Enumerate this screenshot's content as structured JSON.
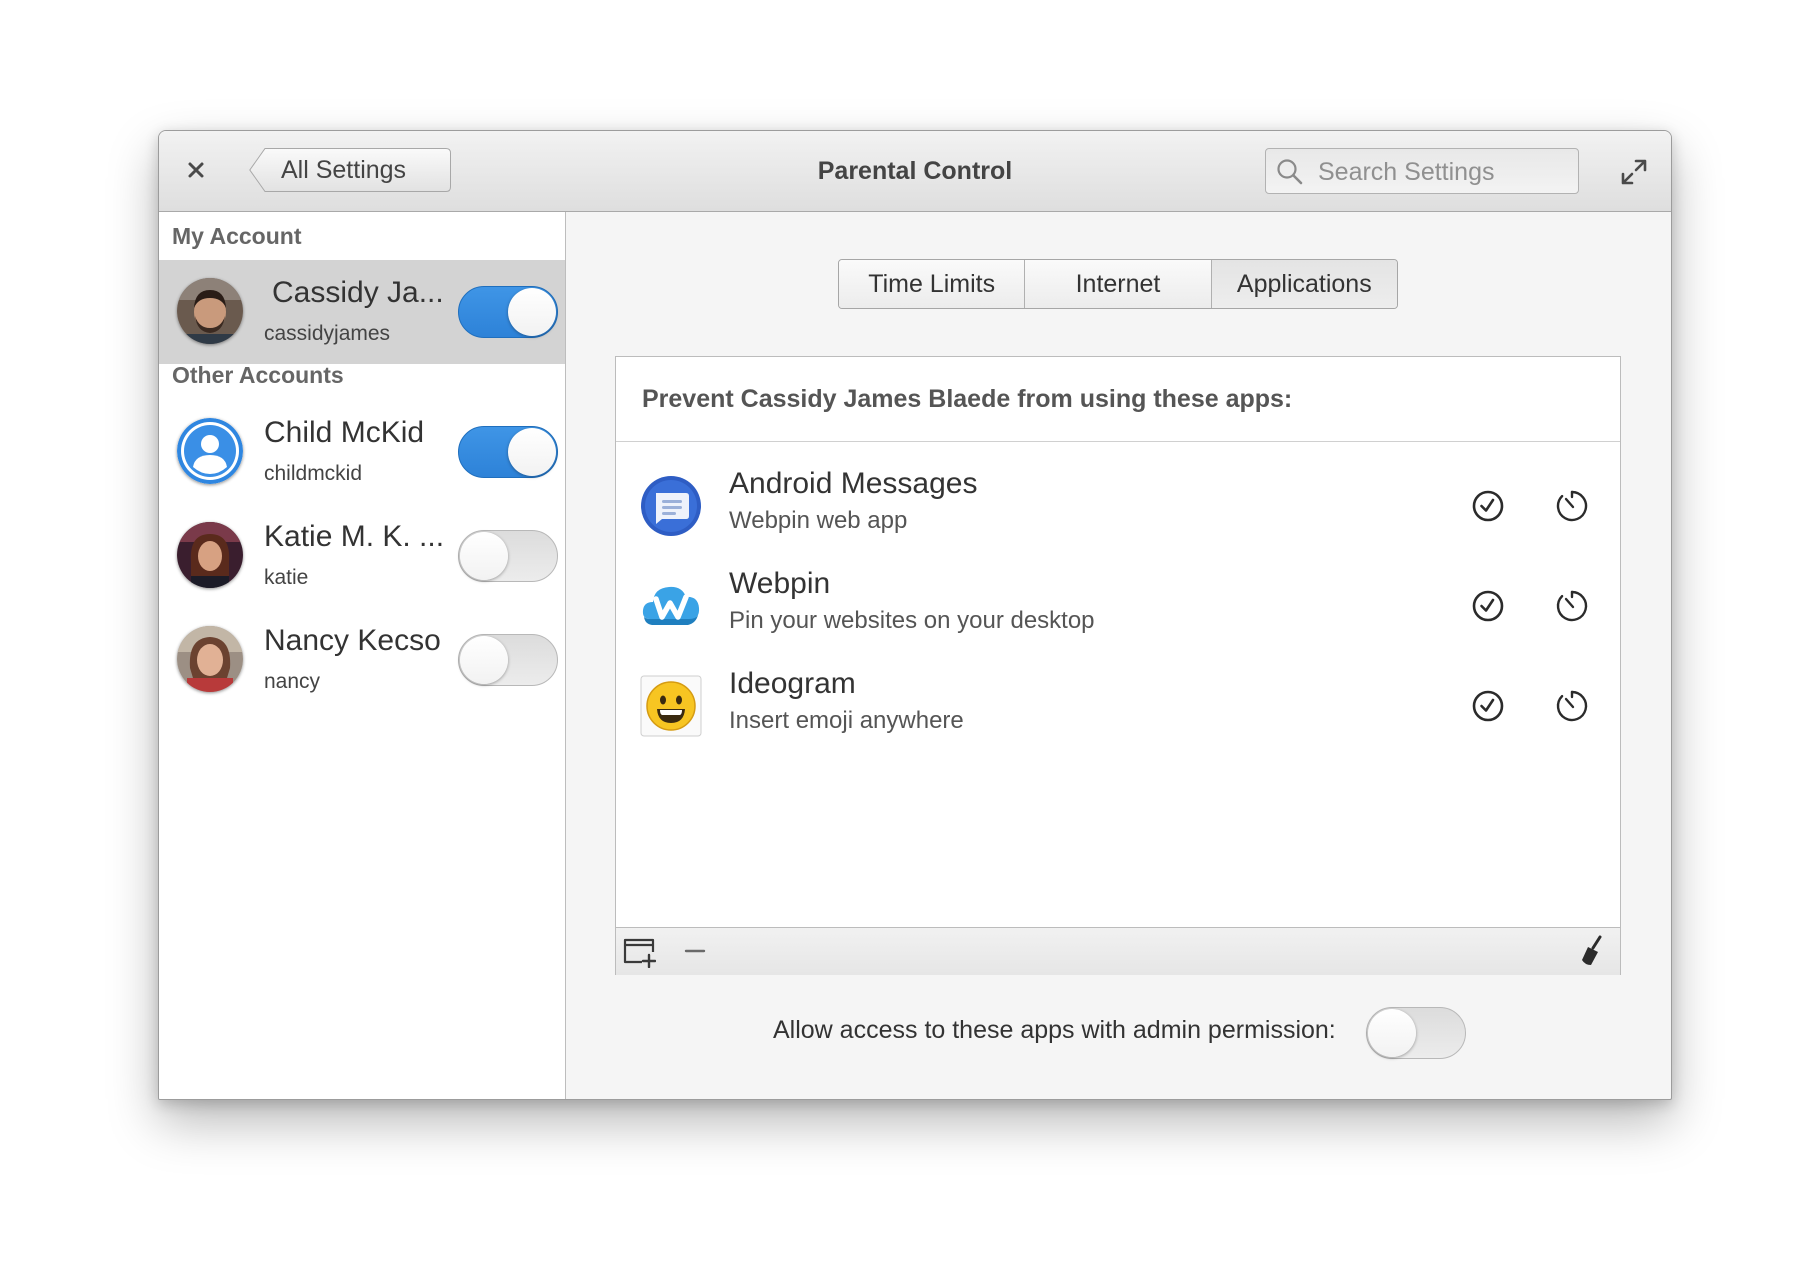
{
  "window": {
    "title": "Parental Control"
  },
  "header": {
    "back_label": "All Settings",
    "search_placeholder": "Search Settings",
    "close_icon": "close-icon",
    "maximize_icon": "maximize-icon"
  },
  "sidebar": {
    "my_account_header": "My Account",
    "other_accounts_header": "Other Accounts",
    "my_account": {
      "name": "Cassidy Ja...",
      "username": "cassidyjames",
      "enabled": true,
      "selected": true
    },
    "others": [
      {
        "name": "Child McKid",
        "username": "childmckid",
        "enabled": true
      },
      {
        "name": "Katie M. K. ...",
        "username": "katie",
        "enabled": false
      },
      {
        "name": "Nancy Kecso",
        "username": "nancy",
        "enabled": false
      }
    ]
  },
  "tabs": [
    {
      "label": "Time Limits",
      "active": false
    },
    {
      "label": "Internet",
      "active": false
    },
    {
      "label": "Applications",
      "active": true
    }
  ],
  "apps_panel": {
    "title": "Prevent Cassidy James Blaede from using these apps:",
    "apps": [
      {
        "name": "Android Messages",
        "description": "Webpin web app",
        "icon": "android-messages-icon"
      },
      {
        "name": "Webpin",
        "description": "Pin your websites on your desktop",
        "icon": "webpin-icon"
      },
      {
        "name": "Ideogram",
        "description": "Insert emoji anywhere",
        "icon": "ideogram-icon"
      }
    ],
    "toolbar": {
      "add_icon": "add-app-icon",
      "remove_icon": "remove-icon",
      "clear_icon": "clear-broom-icon"
    }
  },
  "admin_permission": {
    "label": "Allow access to these apps with admin permission:",
    "enabled": false
  },
  "colors": {
    "accent": "#3689e6",
    "selected_row": "#d3d3d3"
  }
}
